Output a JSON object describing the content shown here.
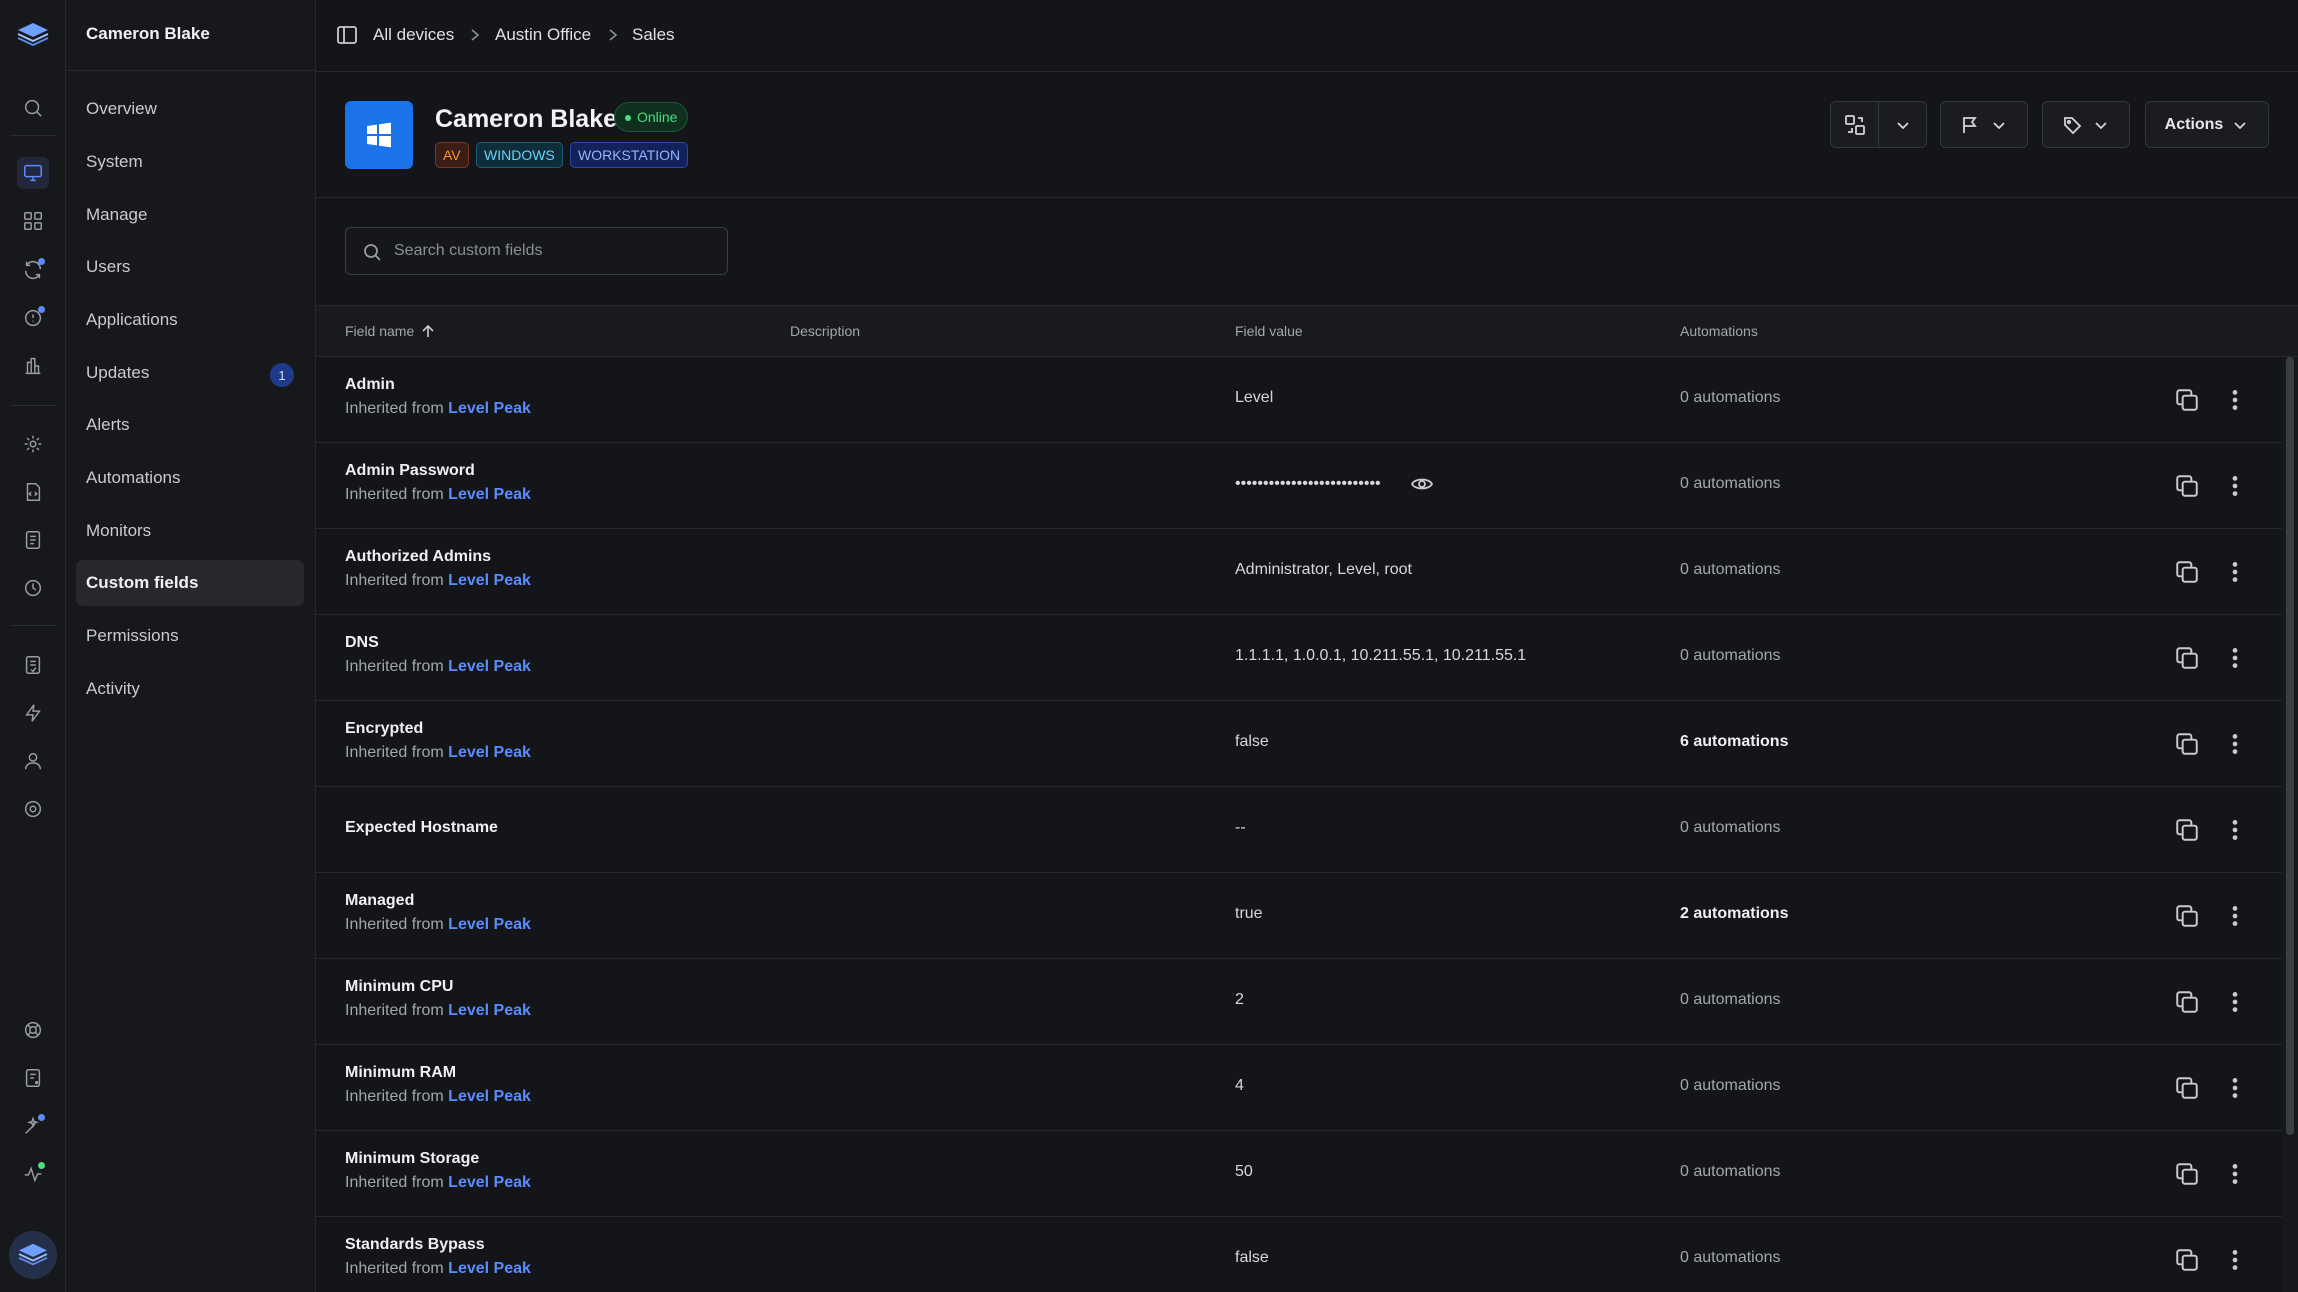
{
  "user": {
    "name": "Cameron Blake"
  },
  "nav": {
    "items": [
      {
        "label": "Overview"
      },
      {
        "label": "System"
      },
      {
        "label": "Manage"
      },
      {
        "label": "Users"
      },
      {
        "label": "Applications"
      },
      {
        "label": "Updates",
        "badge": "1"
      },
      {
        "label": "Alerts"
      },
      {
        "label": "Automations"
      },
      {
        "label": "Monitors"
      },
      {
        "label": "Custom fields",
        "active": true
      },
      {
        "label": "Permissions"
      },
      {
        "label": "Activity"
      }
    ]
  },
  "breadcrumb": [
    "All devices",
    "Austin Office",
    "Sales"
  ],
  "device": {
    "name": "Cameron Blake",
    "status": "Online",
    "tags": [
      "AV",
      "WINDOWS",
      "WORKSTATION"
    ]
  },
  "header_actions": {
    "actions_label": "Actions"
  },
  "search": {
    "placeholder": "Search custom fields",
    "value": ""
  },
  "table": {
    "columns": [
      "Field name",
      "Description",
      "Field value",
      "Automations"
    ],
    "inherited_prefix": "Inherited from",
    "inherited_source": "Level Peak",
    "rows": [
      {
        "name": "Admin",
        "inherited": true,
        "value": "Level",
        "automations": "0 automations"
      },
      {
        "name": "Admin Password",
        "inherited": true,
        "value": "••••••••••••••••••••••••••",
        "automations": "0 automations",
        "masked": true
      },
      {
        "name": "Authorized Admins",
        "inherited": true,
        "value": "Administrator, Level, root",
        "automations": "0 automations"
      },
      {
        "name": "DNS",
        "inherited": true,
        "value": "1.1.1.1, 1.0.0.1, 10.211.55.1, 10.211.55.1",
        "automations": "0 automations"
      },
      {
        "name": "Encrypted",
        "inherited": true,
        "value": "false",
        "automations": "6 automations",
        "highlight": true
      },
      {
        "name": "Expected Hostname",
        "inherited": false,
        "value": "--",
        "automations": "0 automations"
      },
      {
        "name": "Managed",
        "inherited": true,
        "value": "true",
        "automations": "2 automations",
        "highlight": true
      },
      {
        "name": "Minimum CPU",
        "inherited": true,
        "value": "2",
        "automations": "0 automations"
      },
      {
        "name": "Minimum RAM",
        "inherited": true,
        "value": "4",
        "automations": "0 automations"
      },
      {
        "name": "Minimum Storage",
        "inherited": true,
        "value": "50",
        "automations": "0 automations"
      },
      {
        "name": "Standards Bypass",
        "inherited": true,
        "value": "false",
        "automations": "0 automations"
      }
    ]
  },
  "icons": {
    "rail": [
      "search-icon",
      "devices-icon",
      "apps-grid-icon",
      "sync-icon",
      "alert-clock-icon",
      "reports-chart-icon",
      "settings-gear-icon",
      "script-icon",
      "document-icon",
      "history-icon",
      "checklist-icon",
      "lightning-icon",
      "user-icon",
      "cog-icon",
      "help-lifebuoy-icon",
      "feedback-icon",
      "sparkle-icon",
      "activity-pulse-icon"
    ]
  },
  "colors": {
    "accent": "#5b8cff",
    "online": "#4ade80",
    "windows_blue": "#1a73e8"
  }
}
